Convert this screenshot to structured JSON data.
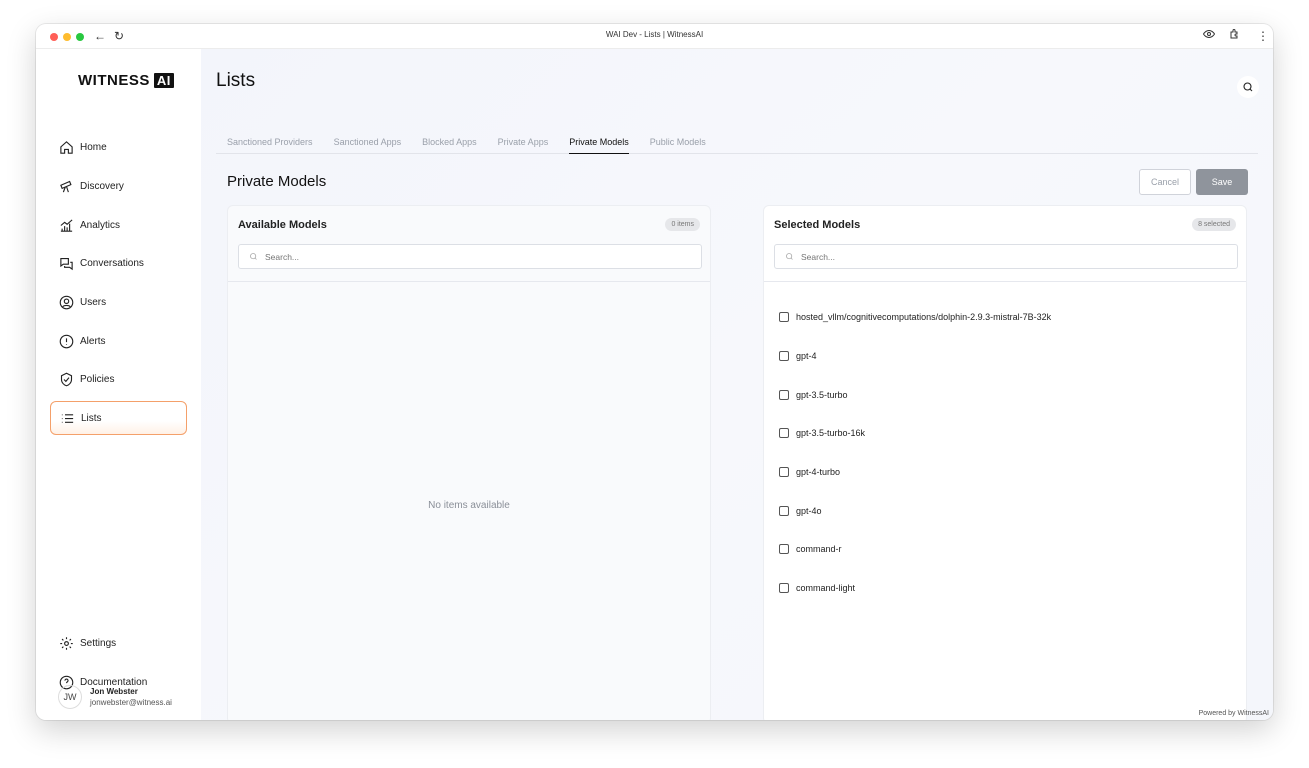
{
  "window": {
    "title": "WAI Dev - Lists | WitnessAI"
  },
  "brand": {
    "name": "WITNESS",
    "badge": "AI"
  },
  "sidebar": {
    "items": [
      {
        "label": "Home",
        "icon": "home-icon"
      },
      {
        "label": "Discovery",
        "icon": "telescope-icon"
      },
      {
        "label": "Analytics",
        "icon": "analytics-icon"
      },
      {
        "label": "Conversations",
        "icon": "chat-icon"
      },
      {
        "label": "Users",
        "icon": "user-icon"
      },
      {
        "label": "Alerts",
        "icon": "alert-icon"
      },
      {
        "label": "Policies",
        "icon": "shield-icon"
      },
      {
        "label": "Lists",
        "icon": "list-icon",
        "active": true
      }
    ],
    "bottom_items": [
      {
        "label": "Settings",
        "icon": "gear-icon"
      },
      {
        "label": "Documentation",
        "icon": "help-icon"
      }
    ],
    "user": {
      "initials": "JW",
      "name": "Jon Webster",
      "email": "jonwebster@witness.ai"
    }
  },
  "page": {
    "title": "Lists"
  },
  "tabs": [
    {
      "label": "Sanctioned Providers"
    },
    {
      "label": "Sanctioned Apps"
    },
    {
      "label": "Blocked Apps"
    },
    {
      "label": "Private Apps"
    },
    {
      "label": "Private Models",
      "active": true
    },
    {
      "label": "Public Models"
    }
  ],
  "section": {
    "title": "Private Models",
    "cancel_label": "Cancel",
    "save_label": "Save"
  },
  "available": {
    "title": "Available Models",
    "count": "0 items",
    "search_placeholder": "Search...",
    "empty_text": "No items available"
  },
  "selected": {
    "title": "Selected Models",
    "count": "8 selected",
    "search_placeholder": "Search...",
    "items": [
      "hosted_vllm/cognitivecomputations/dolphin-2.9.3-mistral-7B-32k",
      "gpt-4",
      "gpt-3.5-turbo",
      "gpt-3.5-turbo-16k",
      "gpt-4-turbo",
      "gpt-4o",
      "command-r",
      "command-light"
    ]
  },
  "transfer": {
    "move_all_right": "»",
    "move_right": "›",
    "move_left": "‹",
    "move_all_left": "«"
  },
  "footer": {
    "powered": "Powered by WitnessAI"
  },
  "colors": {
    "accent": "#f4a06a",
    "save_button": "#8f949c"
  }
}
